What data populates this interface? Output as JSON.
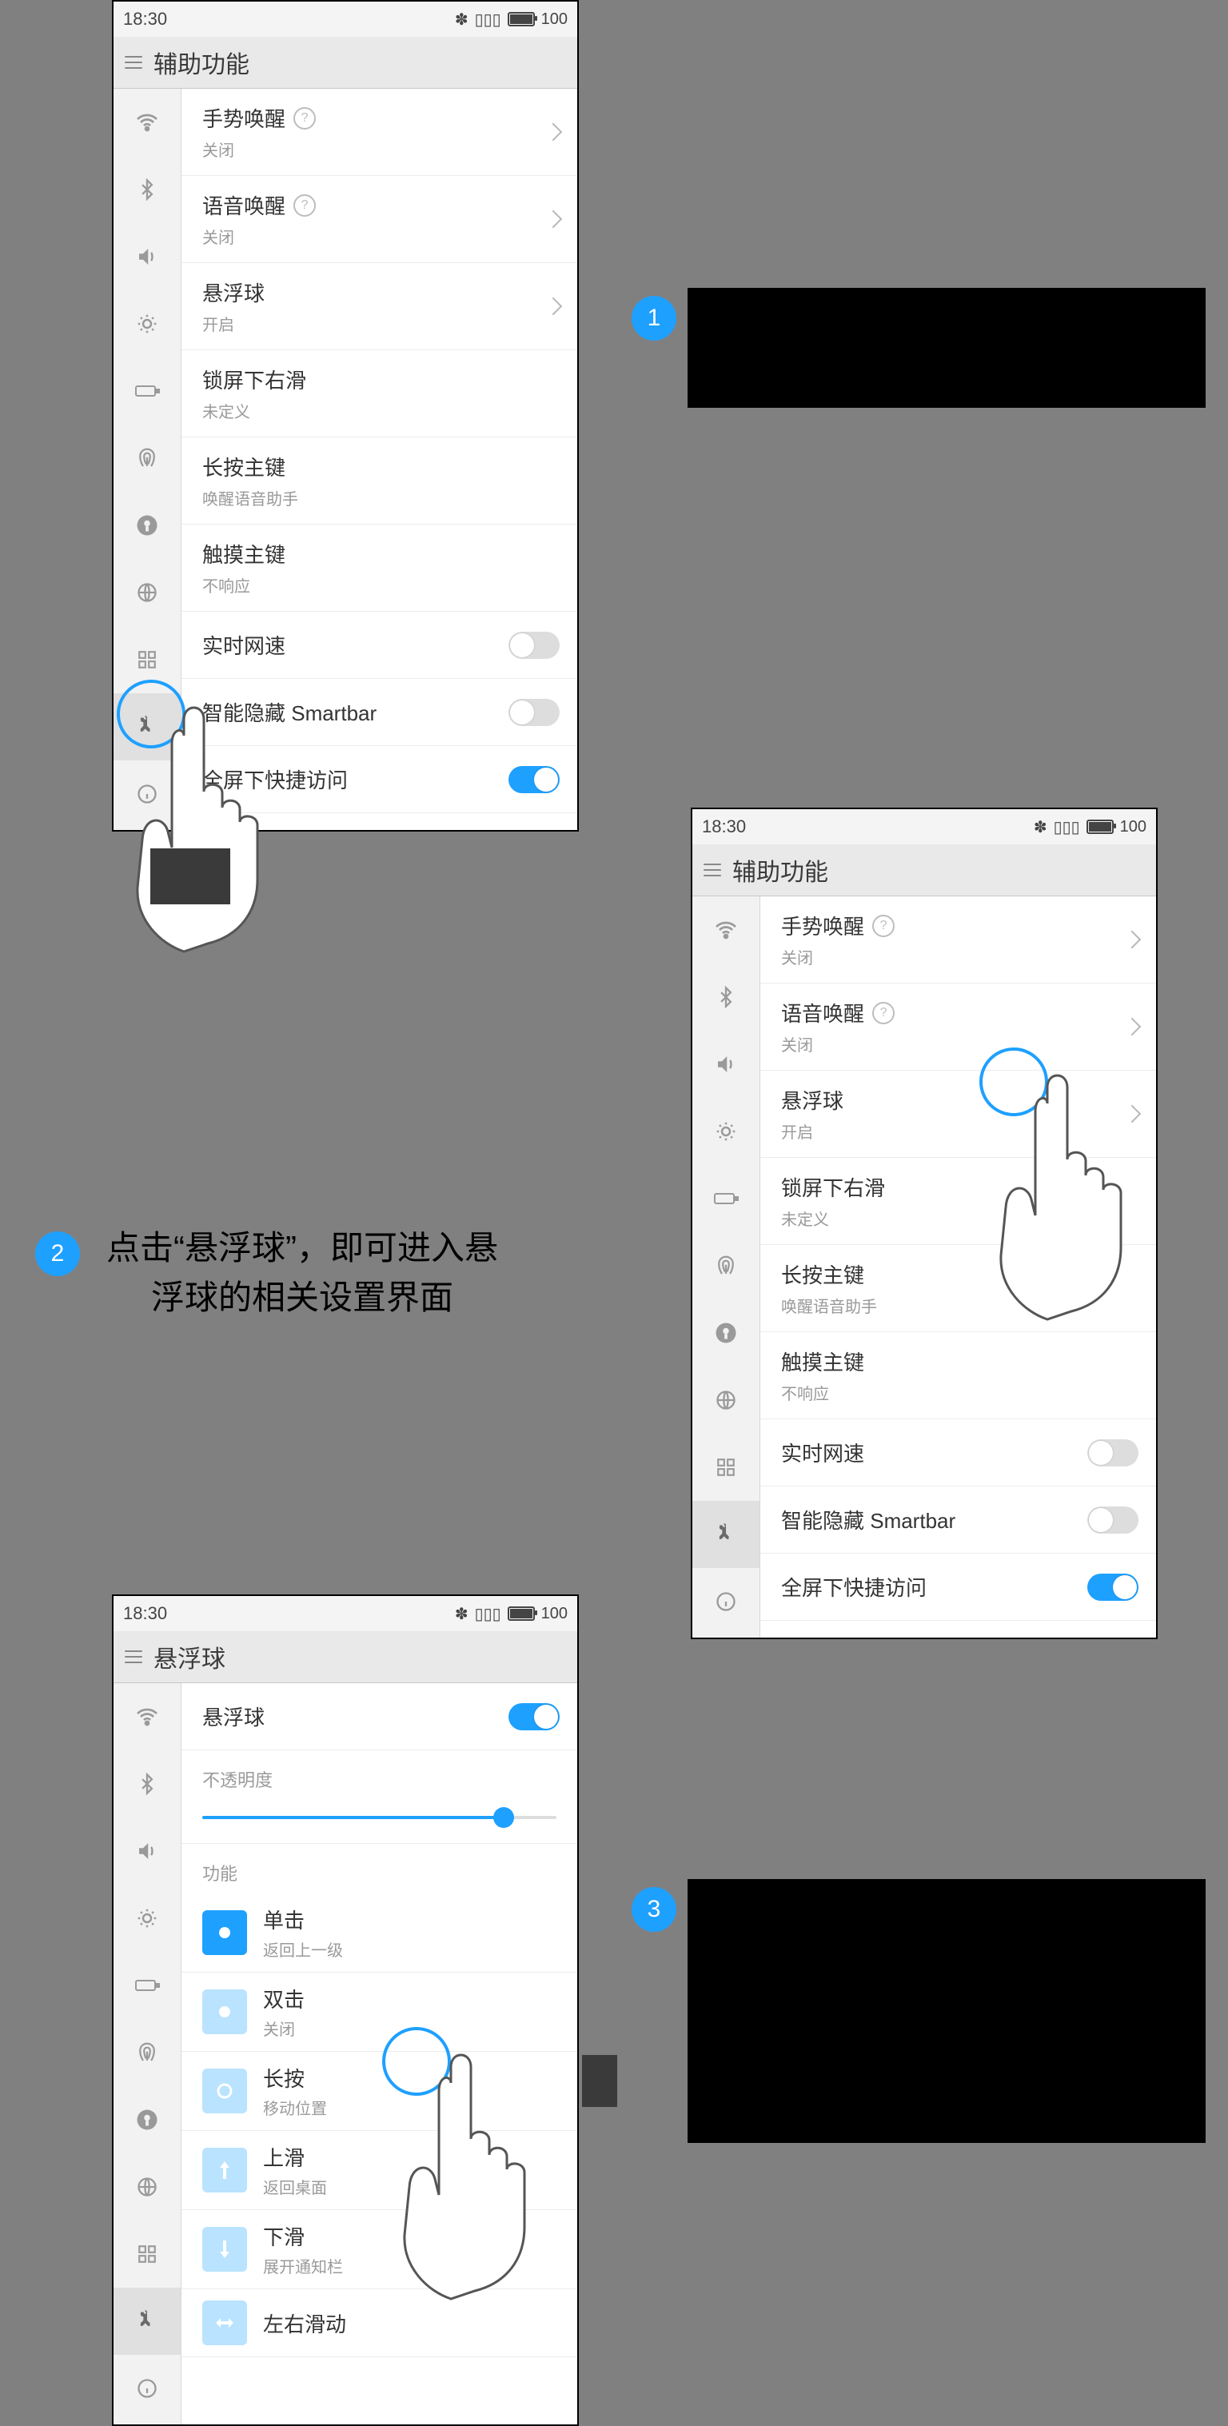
{
  "status": {
    "time": "18:30",
    "bt": "⁂",
    "signal": "▮▮▮",
    "battery": "100"
  },
  "screens": {
    "p1": {
      "title": "辅助功能",
      "rows": [
        {
          "title": "手势唤醒",
          "sub": "关闭",
          "help": true,
          "chev": true
        },
        {
          "title": "语音唤醒",
          "sub": "关闭",
          "help": true,
          "chev": true
        },
        {
          "title": "悬浮球",
          "sub": "开启",
          "chev": true
        },
        {
          "title": "锁屏下右滑",
          "sub": "未定义"
        },
        {
          "title": "长按主键",
          "sub": "唤醒语音助手"
        },
        {
          "title": "触摸主键",
          "sub": "不响应"
        }
      ],
      "toggles": [
        {
          "title": "实时网速",
          "on": false
        },
        {
          "title": "智能隐藏 Smartbar",
          "on": false
        },
        {
          "title": "全屏下快捷访问",
          "on": true
        }
      ]
    },
    "p2": {
      "title": "辅助功能",
      "rows": [
        {
          "title": "手势唤醒",
          "sub": "关闭",
          "help": true,
          "chev": true
        },
        {
          "title": "语音唤醒",
          "sub": "关闭",
          "help": true,
          "chev": true
        },
        {
          "title": "悬浮球",
          "sub": "开启",
          "chev": true
        },
        {
          "title": "锁屏下右滑",
          "sub": "未定义"
        },
        {
          "title": "长按主键",
          "sub": "唤醒语音助手"
        },
        {
          "title": "触摸主键",
          "sub": "不响应"
        }
      ],
      "toggles": [
        {
          "title": "实时网速",
          "on": false
        },
        {
          "title": "智能隐藏 Smartbar",
          "on": false
        },
        {
          "title": "全屏下快捷访问",
          "on": true
        }
      ]
    },
    "p3": {
      "title": "悬浮球",
      "main_toggle": {
        "title": "悬浮球",
        "on": true
      },
      "opacity_label": "不透明度",
      "opacity_value": 0.85,
      "func_label": "功能",
      "funcs": [
        {
          "title": "单击",
          "sub": "返回上一级",
          "icon": "dot",
          "sel": true
        },
        {
          "title": "双击",
          "sub": "关闭",
          "icon": "dot"
        },
        {
          "title": "长按",
          "sub": "移动位置",
          "icon": "ring"
        },
        {
          "title": "上滑",
          "sub": "返回桌面",
          "icon": "arrow-up"
        },
        {
          "title": "下滑",
          "sub": "展开通知栏",
          "icon": "arrow-down"
        },
        {
          "title": "左右滑动",
          "sub": "",
          "icon": "arrow-lr"
        }
      ]
    }
  },
  "steps": {
    "s1": {
      "n": "1",
      "text": ""
    },
    "s2": {
      "n": "2",
      "text": "点击“悬浮球”，即可进入悬浮球的相关设置界面"
    },
    "s3": {
      "n": "3",
      "text": ""
    }
  }
}
